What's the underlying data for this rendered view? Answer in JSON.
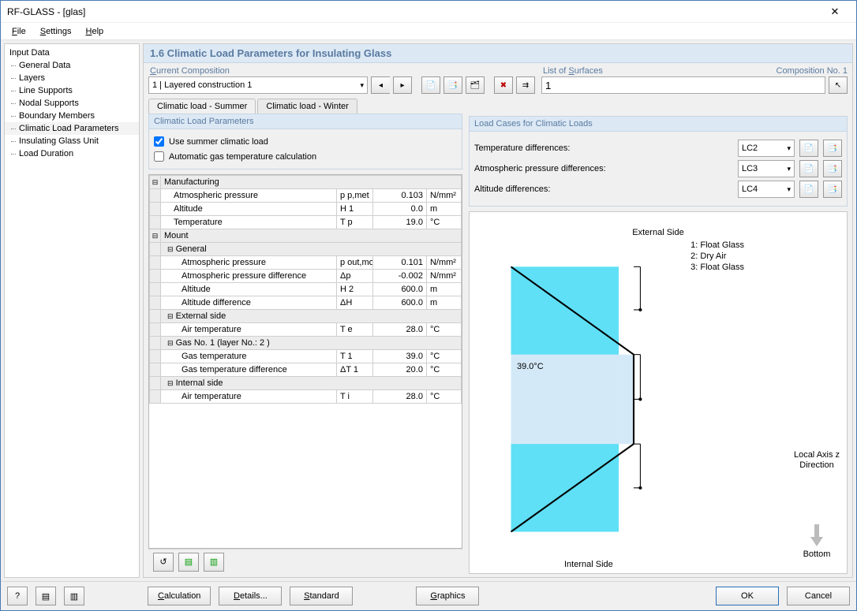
{
  "window": {
    "title": "RF-GLASS - [glas]"
  },
  "menu": {
    "file": "File",
    "settings": "Settings",
    "help": "Help"
  },
  "tree": {
    "root": "Input Data",
    "items": [
      "General Data",
      "Layers",
      "Line Supports",
      "Nodal Supports",
      "Boundary Members",
      "Climatic Load Parameters",
      "Insulating Glass Unit",
      "Load Duration"
    ],
    "selected": 5
  },
  "main": {
    "title": "1.6 Climatic Load Parameters for Insulating Glass"
  },
  "composition": {
    "title": "Current Composition",
    "value": "1 | Layered construction 1"
  },
  "surfaces": {
    "title": "List of Surfaces",
    "comp_no": "Composition No. 1",
    "value": "1"
  },
  "tabs": {
    "summer": "Climatic load - Summer",
    "winter": "Climatic load - Winter"
  },
  "params": {
    "heading": "Climatic Load Parameters",
    "use_summer": "Use summer climatic load",
    "auto_gas": "Automatic gas temperature calculation",
    "rows": {
      "manufacturing": "Manufacturing",
      "atm_p": "Atmospheric pressure",
      "altitude": "Altitude",
      "temperature": "Temperature",
      "mount": "Mount",
      "general": "General",
      "atm_p_diff": "Atmospheric pressure difference",
      "alt_diff": "Altitude difference",
      "ext_side": "External side",
      "air_temp": "Air temperature",
      "gas1": "Gas No. 1 (layer No.: 2 )",
      "gas_temp": "Gas temperature",
      "gas_temp_diff": "Gas temperature difference",
      "int_side": "Internal side"
    },
    "sym": {
      "ppmet": "p p,met",
      "h1": "H 1",
      "tp": "T p",
      "poutm": "p out,mo",
      "dp": "Δp",
      "h2": "H 2",
      "dh": "ΔH",
      "te": "T e",
      "t1": "T 1",
      "dt1": "ΔT 1",
      "ti": "T i"
    },
    "vals": {
      "ppmet": "0.103",
      "h1": "0.0",
      "tp": "19.0",
      "poutm": "0.101",
      "dp": "-0.002",
      "h2": "600.0",
      "dh": "600.0",
      "te": "28.0",
      "t1": "39.0",
      "dt1": "20.0",
      "ti": "28.0"
    },
    "units": {
      "nmm2": "N/mm²",
      "m": "m",
      "c": "°C"
    }
  },
  "loadcases": {
    "heading": "Load Cases for Climatic Loads",
    "temp": "Temperature differences:",
    "atm": "Atmospheric pressure differences:",
    "alt": "Altitude differences:",
    "lc_temp": "LC2",
    "lc_atm": "LC3",
    "lc_alt": "LC4"
  },
  "diagram": {
    "ext": "External Side",
    "int": "Internal Side",
    "l1": "1: Float Glass",
    "l2": "2: Dry Air",
    "l3": "3: Float Glass",
    "temp": "39.0°C",
    "axis": "Local Axis z\nDirection",
    "bottom": "Bottom"
  },
  "footer": {
    "calc": "Calculation",
    "details": "Details...",
    "standard": "Standard",
    "graphics": "Graphics",
    "ok": "OK",
    "cancel": "Cancel"
  }
}
